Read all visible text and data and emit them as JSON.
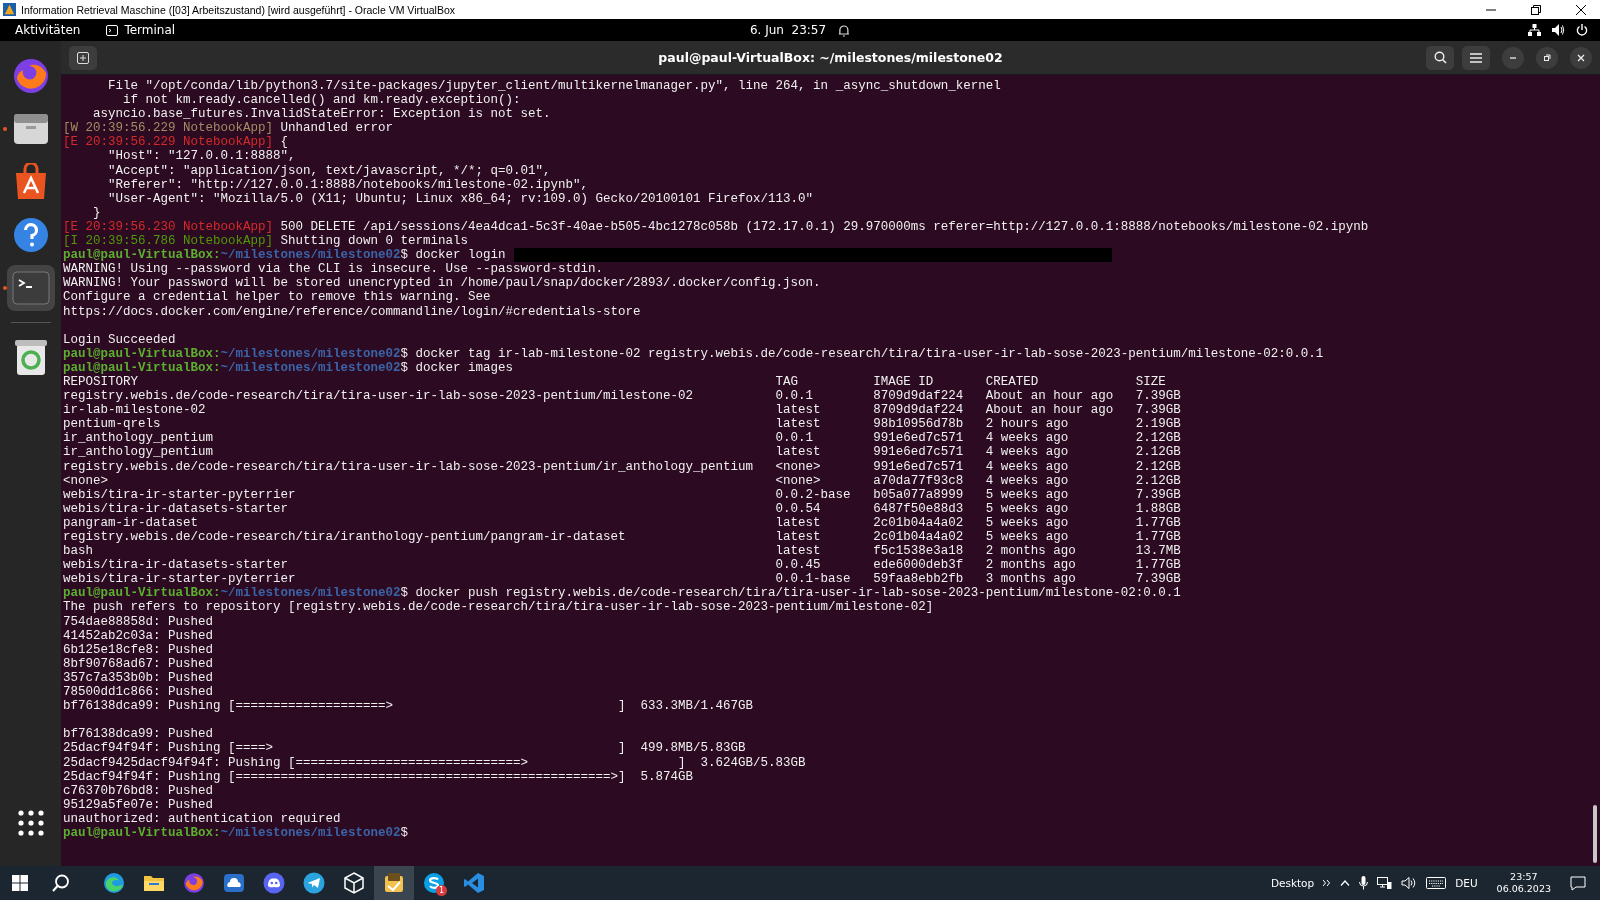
{
  "vm_window": {
    "title": "Information Retrieval Maschine ([03] Arbeitszustand) [wird ausgeführt] - Oracle VM VirtualBox"
  },
  "top_bar": {
    "activities": "Aktivitäten",
    "app": "Terminal",
    "clock": "6. Jun  23:57"
  },
  "dock": {
    "items": [
      {
        "kind": "firefox",
        "running": false,
        "selected": false
      },
      {
        "kind": "files",
        "running": true,
        "selected": false
      },
      {
        "kind": "store",
        "running": false,
        "selected": false
      },
      {
        "kind": "help",
        "running": false,
        "selected": false
      },
      {
        "kind": "terminal",
        "running": true,
        "selected": true
      },
      {
        "kind": "trash",
        "running": false,
        "selected": false
      }
    ]
  },
  "terminal": {
    "title": "paul@paul-VirtualBox: ~/milestones/milestone02",
    "lines": [
      {
        "kind": "text",
        "text": "      File \"/opt/conda/lib/python3.7/site-packages/jupyter_client/multikernelmanager.py\", line 264, in _async_shutdown_kernel"
      },
      {
        "kind": "text",
        "text": "        if not km.ready.cancelled() and km.ready.exception():"
      },
      {
        "kind": "text",
        "text": "    asyncio.base_futures.InvalidStateError: Exception is not set."
      },
      {
        "kind": "log",
        "color": "#a38b63",
        "tag": "[W 20:39:56.229 NotebookApp]",
        "text": "Unhandled error"
      },
      {
        "kind": "log",
        "color": "#d42a2a",
        "tag": "[E 20:39:56.229 NotebookApp]",
        "text": "{"
      },
      {
        "kind": "text",
        "text": "      \"Host\": \"127.0.0.1:8888\","
      },
      {
        "kind": "text",
        "text": "      \"Accept\": \"application/json, text/javascript, */*; q=0.01\","
      },
      {
        "kind": "text",
        "text": "      \"Referer\": \"http://127.0.0.1:8888/notebooks/milestone-02.ipynb\","
      },
      {
        "kind": "text",
        "text": "      \"User-Agent\": \"Mozilla/5.0 (X11; Ubuntu; Linux x86_64; rv:109.0) Gecko/20100101 Firefox/113.0\""
      },
      {
        "kind": "text",
        "text": "    }"
      },
      {
        "kind": "log",
        "color": "#d42a2a",
        "tag": "[E 20:39:56.230 NotebookApp]",
        "text": "500 DELETE /api/sessions/4ea4dca1-5c3f-40ae-b505-4bc1278c058b (172.17.0.1) 29.970000ms referer=http://127.0.0.1:8888/notebooks/milestone-02.ipynb"
      },
      {
        "kind": "log",
        "color": "#4e9a06",
        "tag": "[I 20:39:56.786 NotebookApp]",
        "text": "Shutting down 0 terminals"
      },
      {
        "kind": "prompt",
        "user": "paul@paul-VirtualBox:",
        "path": "~/milestones/milestone02",
        "command": "$ docker login",
        "redacted": true
      },
      {
        "kind": "text",
        "text": "WARNING! Using --password via the CLI is insecure. Use --password-stdin."
      },
      {
        "kind": "text",
        "text": "WARNING! Your password will be stored unencrypted in /home/paul/snap/docker/2893/.docker/config.json."
      },
      {
        "kind": "text",
        "text": "Configure a credential helper to remove this warning. See"
      },
      {
        "kind": "text",
        "text": "https://docs.docker.com/engine/reference/commandline/login/#credentials-store"
      },
      {
        "kind": "blank"
      },
      {
        "kind": "text",
        "text": "Login Succeeded"
      },
      {
        "kind": "prompt",
        "user": "paul@paul-VirtualBox:",
        "path": "~/milestones/milestone02",
        "command": "$ docker tag ir-lab-milestone-02 registry.webis.de/code-research/tira/tira-user-ir-lab-sose-2023-pentium/milestone-02:0.0.1",
        "redacted": false
      },
      {
        "kind": "prompt",
        "user": "paul@paul-VirtualBox:",
        "path": "~/milestones/milestone02",
        "command": "$ docker images",
        "redacted": false
      },
      {
        "kind": "table",
        "columns": [
          "REPOSITORY",
          "TAG",
          "IMAGE ID",
          "CREATED",
          "SIZE"
        ],
        "rows": [
          [
            "registry.webis.de/code-research/tira/tira-user-ir-lab-sose-2023-pentium/milestone-02",
            "0.0.1",
            "8709d9daf224",
            "About an hour ago",
            "7.39GB"
          ],
          [
            "ir-lab-milestone-02",
            "latest",
            "8709d9daf224",
            "About an hour ago",
            "7.39GB"
          ],
          [
            "pentium-qrels",
            "latest",
            "98b10956d78b",
            "2 hours ago",
            "2.19GB"
          ],
          [
            "ir_anthology_pentium",
            "0.0.1",
            "991e6ed7c571",
            "4 weeks ago",
            "2.12GB"
          ],
          [
            "ir_anthology_pentium",
            "latest",
            "991e6ed7c571",
            "4 weeks ago",
            "2.12GB"
          ],
          [
            "registry.webis.de/code-research/tira/tira-user-ir-lab-sose-2023-pentium/ir_anthology_pentium",
            "<none>",
            "991e6ed7c571",
            "4 weeks ago",
            "2.12GB"
          ],
          [
            "<none>",
            "<none>",
            "a70da77f93c8",
            "4 weeks ago",
            "2.12GB"
          ],
          [
            "webis/tira-ir-starter-pyterrier",
            "0.0.2-base",
            "b05a077a8999",
            "5 weeks ago",
            "7.39GB"
          ],
          [
            "webis/tira-ir-datasets-starter",
            "0.0.54",
            "6487f50e88d3",
            "5 weeks ago",
            "1.88GB"
          ],
          [
            "pangram-ir-dataset",
            "latest",
            "2c01b04a4a02",
            "5 weeks ago",
            "1.77GB"
          ],
          [
            "registry.webis.de/code-research/tira/iranthology-pentium/pangram-ir-dataset",
            "latest",
            "2c01b04a4a02",
            "5 weeks ago",
            "1.77GB"
          ],
          [
            "bash",
            "latest",
            "f5c1538e3a18",
            "2 months ago",
            "13.7MB"
          ],
          [
            "webis/tira-ir-datasets-starter",
            "0.0.45",
            "ede6000deb3f",
            "2 months ago",
            "1.77GB"
          ],
          [
            "webis/tira-ir-starter-pyterrier",
            "0.0.1-base",
            "59faa8ebb2fb",
            "3 months ago",
            "7.39GB"
          ]
        ]
      },
      {
        "kind": "prompt",
        "user": "paul@paul-VirtualBox:",
        "path": "~/milestones/milestone02",
        "command": "$ docker push registry.webis.de/code-research/tira/tira-user-ir-lab-sose-2023-pentium/milestone-02:0.0.1",
        "redacted": false
      },
      {
        "kind": "text",
        "text": "The push refers to repository [registry.webis.de/code-research/tira/tira-user-ir-lab-sose-2023-pentium/milestone-02]"
      },
      {
        "kind": "text",
        "text": "754dae88858d: Pushed"
      },
      {
        "kind": "text",
        "text": "41452ab2c03a: Pushed"
      },
      {
        "kind": "text",
        "text": "6b125e18cfe8: Pushed"
      },
      {
        "kind": "text",
        "text": "8bf90768ad67: Pushed"
      },
      {
        "kind": "text",
        "text": "357c7a353b0b: Pushed"
      },
      {
        "kind": "text",
        "text": "78500dd1c866: Pushed"
      },
      {
        "kind": "progress",
        "prefix": "bf76138dca99: Pushing ",
        "open": "[",
        "fill": "====================>",
        "close": "]",
        "amount": "633.3MB/1.467GB"
      },
      {
        "kind": "blank"
      },
      {
        "kind": "text",
        "text": "bf76138dca99: Pushed"
      },
      {
        "kind": "progress",
        "prefix": "25dacf94f94f: Pushing ",
        "open": "[",
        "fill": "====>",
        "close": "]",
        "amount": "499.8MB/5.83GB"
      },
      {
        "kind": "progress",
        "prefix": "25dacf9425dacf94f94f: Pushing ",
        "open": "[",
        "fill": "==============================>",
        "close": "]",
        "amount": "3.624GB/5.83GB"
      },
      {
        "kind": "progress",
        "prefix": "25dacf94f94f: Pushing ",
        "open": "[",
        "fill": "==================================================>",
        "close": "]",
        "amount": "5.874GB"
      },
      {
        "kind": "text",
        "text": "c76370b76bd8: Pushed"
      },
      {
        "kind": "text",
        "text": "95129a5fe07e: Pushed"
      },
      {
        "kind": "text",
        "text": "unauthorized: authentication required"
      },
      {
        "kind": "prompt",
        "user": "paul@paul-VirtualBox:",
        "path": "~/milestones/milestone02",
        "command": "$",
        "redacted": false
      }
    ]
  },
  "taskbar": {
    "apps": [
      {
        "kind": "edge",
        "selected": false
      },
      {
        "kind": "explorer",
        "selected": false
      },
      {
        "kind": "firefox",
        "selected": false
      },
      {
        "kind": "cloud",
        "selected": false
      },
      {
        "kind": "discord",
        "selected": false
      },
      {
        "kind": "telegram",
        "selected": false
      },
      {
        "kind": "cube",
        "selected": false
      },
      {
        "kind": "virtualbox",
        "selected": true
      },
      {
        "kind": "skype",
        "selected": false,
        "badge": "1"
      },
      {
        "kind": "vscode",
        "selected": false
      }
    ],
    "desktop": "Desktop",
    "language": "DEU",
    "time": "23:57",
    "date": "06.06.2023"
  }
}
